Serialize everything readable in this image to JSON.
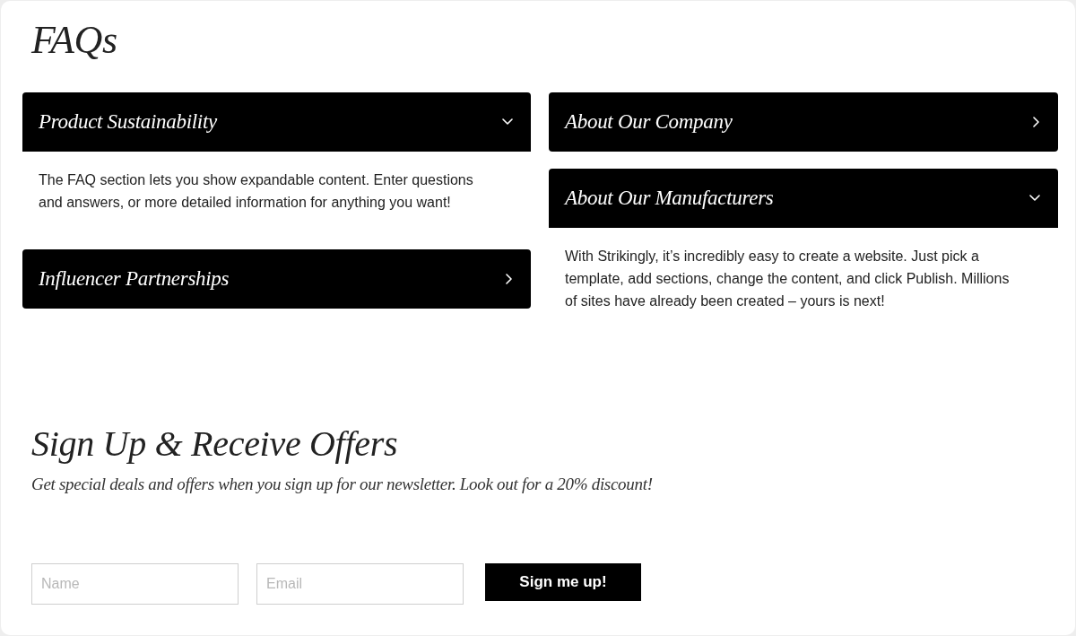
{
  "faq": {
    "title": "FAQs",
    "columns": [
      {
        "items": [
          {
            "question": "Product Sustainability",
            "expanded": true,
            "answer": "The FAQ section lets you show expandable content. Enter questions and answers, or more detailed information for anything you want!"
          },
          {
            "question": "Influencer Partnerships",
            "expanded": false
          }
        ]
      },
      {
        "items": [
          {
            "question": "About Our Company",
            "expanded": false
          },
          {
            "question": "About Our Manufacturers",
            "expanded": true,
            "answer": "With Strikingly, it’s incredibly easy to create a website. Just pick a template, add sections, change the content, and click Publish. Millions of sites have already been created – yours is next!"
          }
        ]
      }
    ]
  },
  "signup": {
    "title": "Sign Up & Receive Offers",
    "subtitle": "Get special deals and offers when you sign up for our newsletter. Look out for a 20% discount!",
    "fields": [
      {
        "placeholder": "Name"
      },
      {
        "placeholder": "Email"
      }
    ],
    "button": "Sign me up!"
  }
}
